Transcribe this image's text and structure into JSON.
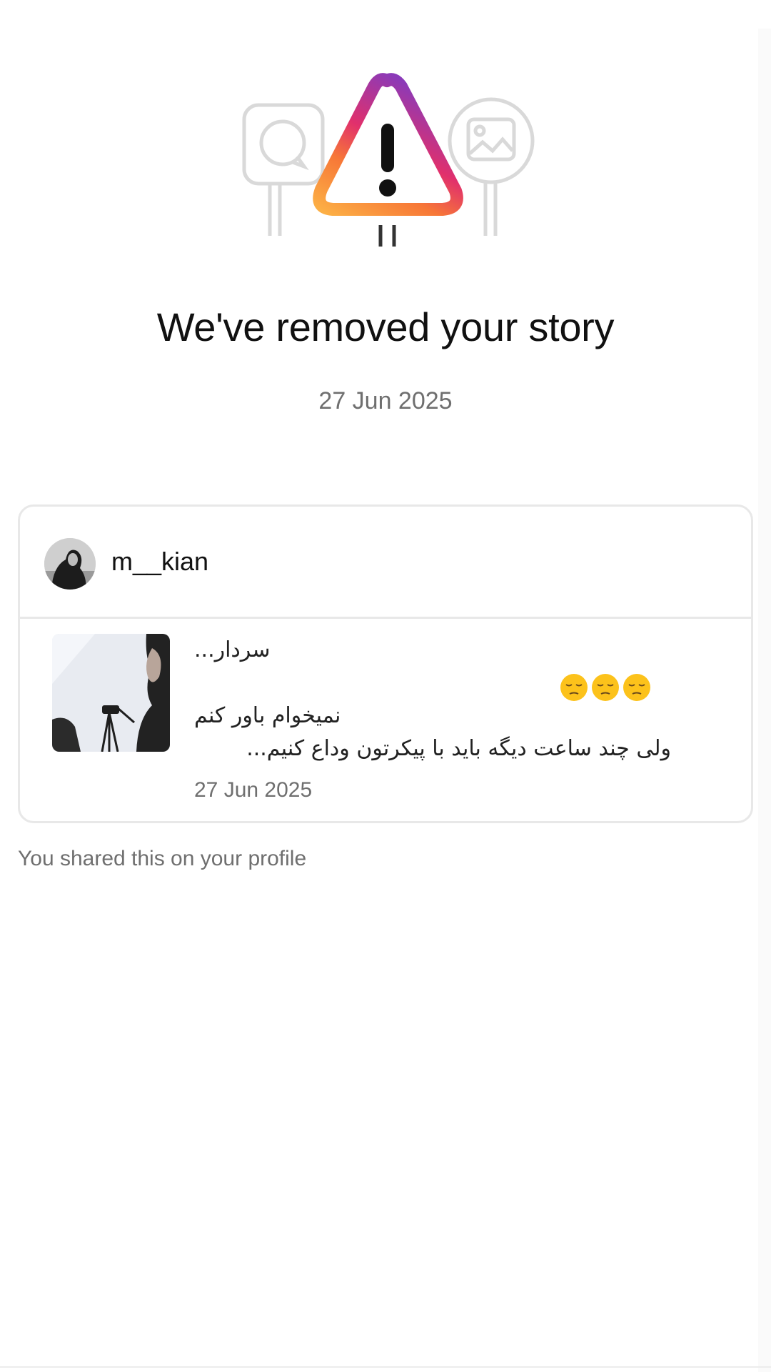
{
  "notice": {
    "title": "We've removed your story",
    "date": "27 Jun 2025",
    "illustration_icon": "warning-triangle-icon",
    "gradient_colors": [
      "#8a3ab9",
      "#e1306c",
      "#fd1d1d",
      "#f77737",
      "#fcaf45"
    ]
  },
  "story_card": {
    "username": "m__kian",
    "avatar_icon": "profile-avatar",
    "caption_lines": [
      "سردار...",
      "",
      "نمیخوام باور کنم",
      "ولی چند ساعت دیگه باید با پیکرتون وداع کنیم..."
    ],
    "emoji_icon": "pensive-face-emoji",
    "emoji_count": 3,
    "date": "27 Jun 2025"
  },
  "footer": {
    "note": "You shared this on your profile"
  }
}
